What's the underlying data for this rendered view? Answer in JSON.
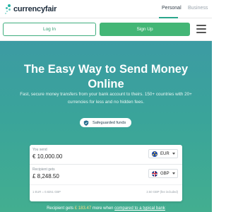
{
  "header": {
    "logo_text": "currencyfair",
    "tabs": [
      {
        "label": "Personal",
        "active": true
      },
      {
        "label": "Business",
        "active": false
      }
    ],
    "icon": "menu-icon"
  },
  "auth": {
    "login_label": "Log In",
    "signup_label": "Sign Up"
  },
  "hero": {
    "title": "The Easy Way to Send Money Online",
    "subtitle": "Fast, secure money transfers from your bank account to theirs. 150+ countries with 20+ currencies for less and no hidden fees.",
    "badge_label": "Safeguarded funds"
  },
  "converter": {
    "send_label": "You send",
    "send_value": "€ 10,000.00",
    "send_currency": "EUR",
    "recv_label": "Recipient gets",
    "recv_value": "£ 8,248.50",
    "recv_currency": "GBP",
    "rate_text": "1 EUR = 0.8251 GBP",
    "fee_text": "2.50 GBP (fee included)"
  },
  "recipient_note": {
    "prefix": "Recipient gets ",
    "amount": "£ 183.47",
    "middle": " more when ",
    "link": "compared to a typical bank"
  },
  "colors": {
    "accent": "#43b676",
    "hero_top": "#3c9ba3",
    "hero_bottom": "#43ae90",
    "highlight": "#f7e08a"
  }
}
